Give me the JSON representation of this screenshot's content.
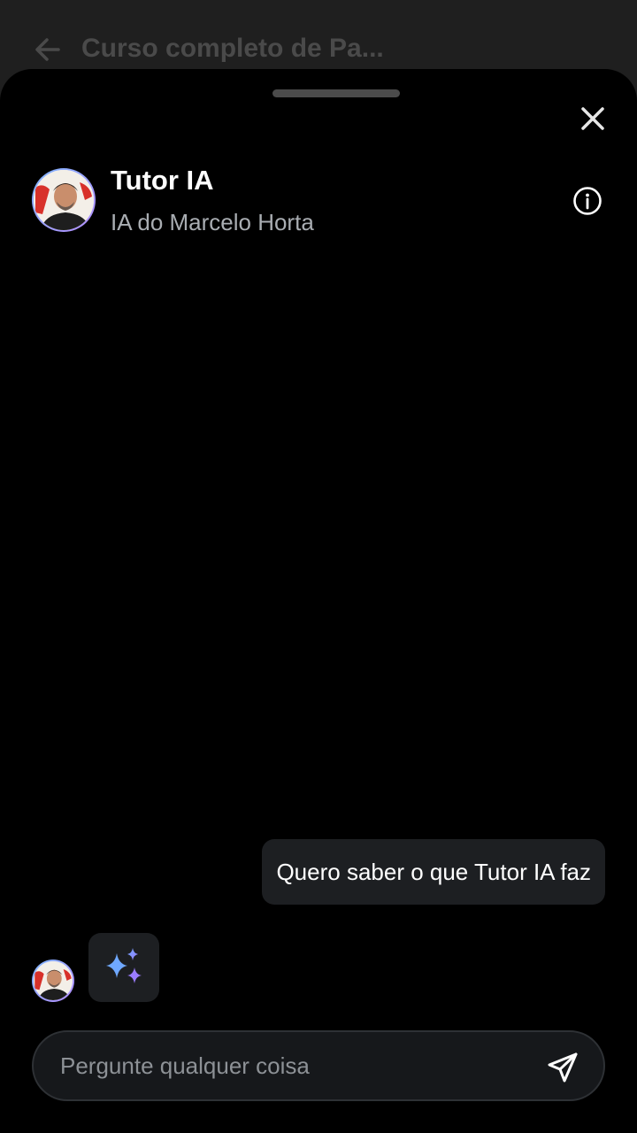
{
  "background": {
    "title": "Curso completo de Pa..."
  },
  "tutor": {
    "name": "Tutor IA",
    "subtitle": "IA do Marcelo Horta"
  },
  "messages": [
    {
      "role": "user",
      "text": "Quero saber o que Tutor IA faz"
    }
  ],
  "composer": {
    "placeholder": "Pergunte qualquer coisa"
  },
  "icons": {
    "back": "arrow-left-icon",
    "close": "close-icon",
    "info": "info-icon",
    "thinking": "sparkles-icon",
    "send": "send-icon"
  },
  "colors": {
    "sheet": "#000000",
    "bubble": "#1d1f22",
    "sparkle_blue": "#6fa8ff",
    "sparkle_purple": "#9b7cff"
  }
}
